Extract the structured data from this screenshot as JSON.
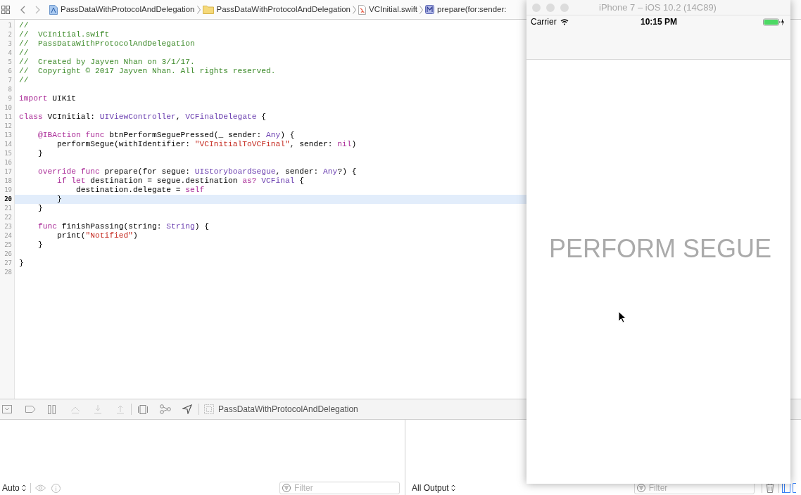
{
  "breadcrumbs": [
    {
      "kind": "project",
      "label": "PassDataWithProtocolAndDelegation"
    },
    {
      "kind": "folder",
      "label": "PassDataWithProtocolAndDelegation"
    },
    {
      "kind": "swift",
      "label": "VCInitial.swift"
    },
    {
      "kind": "method",
      "label": "prepare(for:sender:"
    }
  ],
  "editor": {
    "lines": [
      {
        "number": "1",
        "current": false,
        "tokens": [
          {
            "kind": "comment",
            "text": "//"
          }
        ]
      },
      {
        "number": "2",
        "current": false,
        "tokens": [
          {
            "kind": "comment",
            "text": "//  VCInitial.swift"
          }
        ]
      },
      {
        "number": "3",
        "current": false,
        "tokens": [
          {
            "kind": "comment",
            "text": "//  PassDataWithProtocolAndDelegation"
          }
        ]
      },
      {
        "number": "4",
        "current": false,
        "tokens": [
          {
            "kind": "comment",
            "text": "//"
          }
        ]
      },
      {
        "number": "5",
        "current": false,
        "tokens": [
          {
            "kind": "comment",
            "text": "//  Created by Jayven Nhan on 3/1/17."
          }
        ]
      },
      {
        "number": "6",
        "current": false,
        "tokens": [
          {
            "kind": "comment",
            "text": "//  Copyright © 2017 Jayven Nhan. All rights reserved."
          }
        ]
      },
      {
        "number": "7",
        "current": false,
        "tokens": [
          {
            "kind": "comment",
            "text": "//"
          }
        ]
      },
      {
        "number": "8",
        "current": false
      },
      {
        "number": "9",
        "current": false,
        "tokens": [
          {
            "kind": "keyword",
            "text": "import"
          },
          {
            "kind": "plain",
            "text": " UIKit"
          }
        ]
      },
      {
        "number": "10",
        "current": false
      },
      {
        "number": "11",
        "current": false,
        "tokens": [
          {
            "kind": "keyword",
            "text": "class"
          },
          {
            "kind": "plain",
            "text": " VCInitial: "
          },
          {
            "kind": "type",
            "text": "UIViewController"
          },
          {
            "kind": "plain",
            "text": ", "
          },
          {
            "kind": "type",
            "text": "VCFinalDelegate"
          },
          {
            "kind": "plain",
            "text": " {"
          }
        ]
      },
      {
        "number": "12",
        "current": false
      },
      {
        "number": "13",
        "current": false,
        "tokens": [
          {
            "kind": "keyword",
            "text": "    @IBAction func"
          },
          {
            "kind": "plain",
            "text": " btnPerformSeguePressed(_ sender: "
          },
          {
            "kind": "type",
            "text": "Any"
          },
          {
            "kind": "plain",
            "text": ") {"
          }
        ]
      },
      {
        "number": "14",
        "current": false,
        "tokens": [
          {
            "kind": "plain",
            "text": "        performSegue(withIdentifier: "
          },
          {
            "kind": "string",
            "text": "\"VCInitialToVCFinal\""
          },
          {
            "kind": "plain",
            "text": ", sender: "
          },
          {
            "kind": "keyword",
            "text": "nil"
          },
          {
            "kind": "plain",
            "text": ")"
          }
        ]
      },
      {
        "number": "15",
        "current": false,
        "tokens": [
          {
            "kind": "plain",
            "text": "    }"
          }
        ]
      },
      {
        "number": "16",
        "current": false
      },
      {
        "number": "17",
        "current": false,
        "tokens": [
          {
            "kind": "keyword",
            "text": "    override func"
          },
          {
            "kind": "plain",
            "text": " prepare(for segue: "
          },
          {
            "kind": "type",
            "text": "UIStoryboardSegue"
          },
          {
            "kind": "plain",
            "text": ", sender: "
          },
          {
            "kind": "type",
            "text": "Any"
          },
          {
            "kind": "plain",
            "text": "?) {"
          }
        ]
      },
      {
        "number": "18",
        "current": false,
        "tokens": [
          {
            "kind": "keyword",
            "text": "        if let"
          },
          {
            "kind": "plain",
            "text": " destination = segue.destination "
          },
          {
            "kind": "keyword",
            "text": "as?"
          },
          {
            "kind": "type",
            "text": " VCFinal"
          },
          {
            "kind": "plain",
            "text": " {"
          }
        ]
      },
      {
        "number": "19",
        "current": false,
        "tokens": [
          {
            "kind": "plain",
            "text": "            destination.delegate = "
          },
          {
            "kind": "keyword",
            "text": "self"
          }
        ]
      },
      {
        "number": "20",
        "current": true,
        "tokens": [
          {
            "kind": "plain",
            "text": "        }"
          }
        ]
      },
      {
        "number": "21",
        "current": false,
        "tokens": [
          {
            "kind": "plain",
            "text": "    }"
          }
        ]
      },
      {
        "number": "22",
        "current": false
      },
      {
        "number": "23",
        "current": false,
        "tokens": [
          {
            "kind": "keyword",
            "text": "    func"
          },
          {
            "kind": "plain",
            "text": " finishPassing(string: "
          },
          {
            "kind": "type",
            "text": "String"
          },
          {
            "kind": "plain",
            "text": ") {"
          }
        ]
      },
      {
        "number": "24",
        "current": false,
        "tokens": [
          {
            "kind": "plain",
            "text": "        print("
          },
          {
            "kind": "string",
            "text": "\"Notified\""
          },
          {
            "kind": "plain",
            "text": ")"
          }
        ]
      },
      {
        "number": "25",
        "current": false,
        "tokens": [
          {
            "kind": "plain",
            "text": "    }"
          }
        ]
      },
      {
        "number": "26",
        "current": false
      },
      {
        "number": "27",
        "current": false,
        "tokens": [
          {
            "kind": "plain",
            "text": "}"
          }
        ]
      },
      {
        "number": "28",
        "current": false
      }
    ]
  },
  "debug_bar": {
    "target": "PassDataWithProtocolAndDelegation"
  },
  "variables_pane": {
    "scope": "Auto",
    "filter": {
      "placeholder": "Filter"
    }
  },
  "console_pane": {
    "output": "All Output",
    "filter": {
      "placeholder": "Filter"
    }
  },
  "simulator": {
    "title": "iPhone 7 – iOS 10.2 (14C89)",
    "status_bar": {
      "carrier": "Carrier",
      "time": "10:15 PM"
    },
    "button": "PERFORM SEGUE"
  }
}
